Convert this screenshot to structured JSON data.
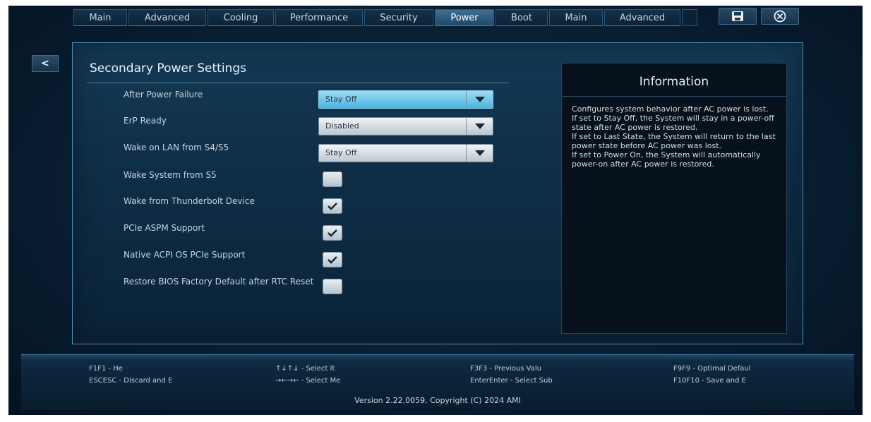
{
  "tabs": [
    {
      "label": "Main",
      "active": false
    },
    {
      "label": "Advanced",
      "active": false
    },
    {
      "label": "Cooling",
      "active": false
    },
    {
      "label": "Performance",
      "active": false
    },
    {
      "label": "Security",
      "active": false
    },
    {
      "label": "Power",
      "active": true
    },
    {
      "label": "Boot",
      "active": false
    },
    {
      "label": "Main",
      "active": false
    },
    {
      "label": "Advanced",
      "active": false
    }
  ],
  "toolbar": {
    "save_icon": "save-icon",
    "close_icon": "close-circle-icon"
  },
  "back_button": {
    "label": "<"
  },
  "section": {
    "title": "Secondary Power Settings"
  },
  "settings": {
    "after_power_failure": {
      "label": "After Power Failure",
      "value": "Stay Off"
    },
    "erp_ready": {
      "label": "ErP Ready",
      "value": "Disabled"
    },
    "wake_on_lan": {
      "label": "Wake on LAN from S4/S5",
      "value": "Stay Off"
    },
    "wake_system_s5": {
      "label": "Wake System from S5",
      "checked": false
    },
    "wake_thunderbolt": {
      "label": "Wake from Thunderbolt Device",
      "checked": true
    },
    "pcie_aspm": {
      "label": "PCIe ASPM Support",
      "checked": true
    },
    "native_acpi": {
      "label": "Native ACPI OS PCIe Support",
      "checked": true
    },
    "restore_bios": {
      "label": "Restore BIOS Factory Default after RTC Reset",
      "checked": false
    }
  },
  "info": {
    "title": "Information",
    "lines": [
      "Configures system behavior after AC power is lost.",
      "If set to Stay Off, the System will stay in a power-off state after AC power is restored.",
      "If set to Last State, the System will return to the last power state before AC power was lost.",
      "If set to Power On, the System will automatically power-on after AC power is restored."
    ]
  },
  "footer": {
    "hotkeys": [
      {
        "text": "F1F1 - He"
      },
      {
        "text": "ESCESC - Discard and E"
      },
      {
        "text": "↑↓↑↓ - Select It"
      },
      {
        "text": "→←→← - Select Me"
      },
      {
        "text": "F3F3 - Previous Valu"
      },
      {
        "text": "EnterEnter - Select Sub"
      },
      {
        "text": "F9F9 - Optimal Defaul"
      },
      {
        "text": "F10F10 - Save and E"
      }
    ],
    "version": "Version 2.22.0059. Copyright (C) 2024 AMI"
  },
  "colors": {
    "accent": "#4bb4e0",
    "active_tab": "#2f5d80",
    "background": "#0a2236"
  }
}
